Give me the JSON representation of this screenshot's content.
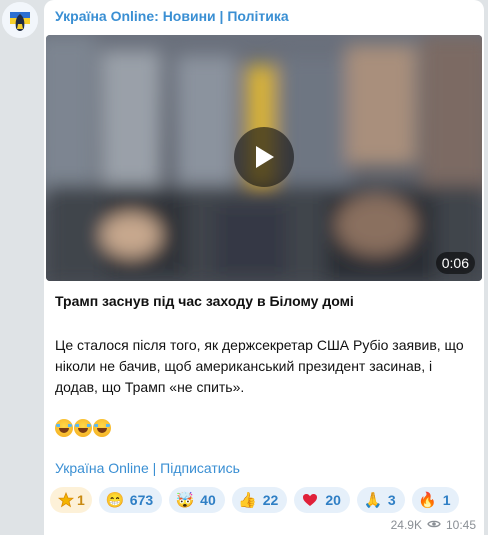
{
  "post": {
    "channel_name": "Україна Online: Новини | Політика",
    "video_duration": "0:06",
    "headline": "Трамп заснув під час заходу в Білому домі",
    "body_line1": "Це сталося після того, як держсекретар США Рубіо заявив, що",
    "body_line2": "ніколи не бачив, щоб американський президент засинав, і",
    "body_line3": "додав, що Трамп «не спить».",
    "subscribe_link": "Україна Online | Підписатись",
    "views": "24.9K",
    "time": "10:45"
  },
  "reactions": [
    {
      "icon": "star-icon",
      "count": "1"
    },
    {
      "icon": "grinning-face-icon",
      "count": "673"
    },
    {
      "icon": "exploding-head-icon",
      "count": "40"
    },
    {
      "icon": "thumbs-up-icon",
      "count": "22"
    },
    {
      "icon": "red-heart-icon",
      "count": "20"
    },
    {
      "icon": "folded-hands-icon",
      "count": "3"
    },
    {
      "icon": "fire-icon",
      "count": "1"
    }
  ],
  "colors": {
    "link": "#3a8fd3",
    "reaction_bg": "#e6f0fa",
    "star_reaction_bg": "#fdf1d8",
    "chat_bg": "#dfe3e6"
  }
}
